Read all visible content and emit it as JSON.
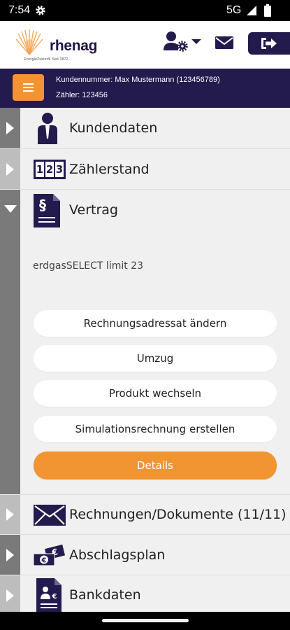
{
  "status_bar": {
    "time": "7:54",
    "network": "5G"
  },
  "header": {
    "logo_text": "rhenag",
    "logo_subtitle": "EnergieZukunft. Seit 1872.",
    "brand_color": "#231a4e",
    "accent_color": "#f39433"
  },
  "customer_bar": {
    "customer_line": "Kundennummer: Max Mustermann (123456789)",
    "meter_line": "Zähler: 123456"
  },
  "sections": [
    {
      "label": "Kundendaten",
      "icon": "person-icon",
      "expanded": false
    },
    {
      "label": "Zählerstand",
      "icon": "meter-counter-icon",
      "expanded": false,
      "counter_digits": [
        "1",
        "2",
        "3"
      ]
    },
    {
      "label": "Vertrag",
      "icon": "contract-document-icon",
      "expanded": true,
      "document_symbol": "§"
    },
    {
      "label": "Rechnungen/Dokumente (11/11)",
      "icon": "envelope-icon",
      "expanded": false
    },
    {
      "label": "Abschlagsplan",
      "icon": "euro-cards-icon",
      "expanded": false
    },
    {
      "label": "Bankdaten",
      "icon": "bank-document-icon",
      "expanded": false
    }
  ],
  "contract": {
    "tariff": "erdgasSELECT limit 23",
    "actions": [
      "Rechnungsadressat ändern",
      "Umzug",
      "Produkt wechseln",
      "Simulationsrechnung erstellen"
    ],
    "details_label": "Details"
  }
}
